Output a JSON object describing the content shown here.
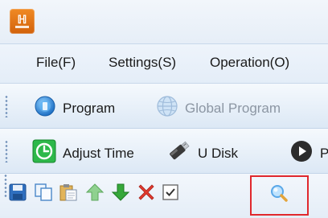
{
  "app": {
    "logo_icon": "app-logo-icon",
    "accent": "#e3781b"
  },
  "menu": {
    "items": [
      {
        "label": "File(F)"
      },
      {
        "label": "Settings(S)"
      },
      {
        "label": "Operation(O)"
      }
    ]
  },
  "toolbar1": {
    "program_label": "Program",
    "global_program_label": "Global Program"
  },
  "toolbar2": {
    "adjust_time_label": "Adjust Time",
    "u_disk_label": "U Disk",
    "partial_label": "P"
  },
  "toolbar3": {
    "icons": [
      "save-icon",
      "copy-icon",
      "paste-icon",
      "move-up-icon",
      "move-down-icon",
      "delete-icon",
      "checkbox-icon",
      "search-icon"
    ]
  },
  "colors": {
    "highlight": "#e0282d"
  }
}
